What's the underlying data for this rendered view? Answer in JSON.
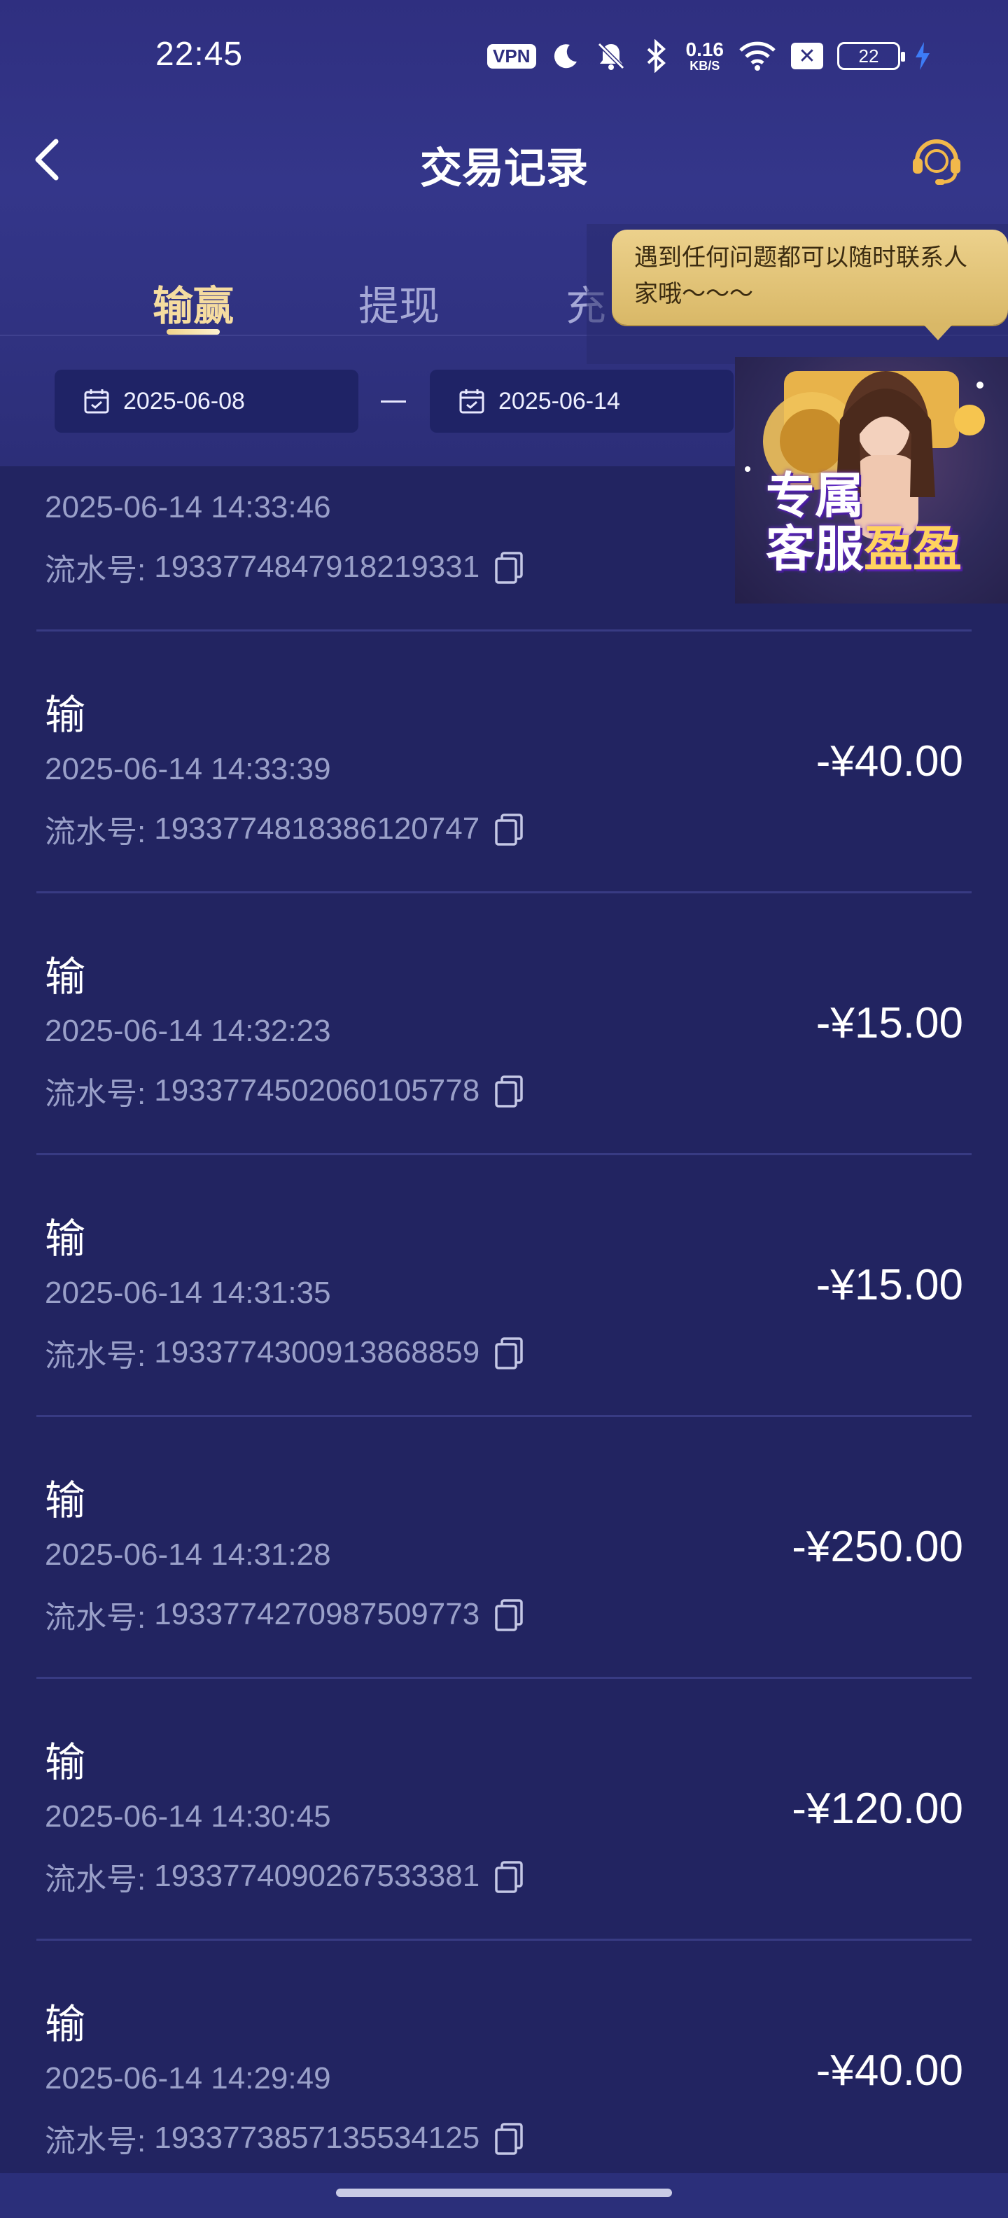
{
  "status_bar": {
    "time": "22:45",
    "vpn": "VPN",
    "net_speed_value": "0.16",
    "net_speed_unit": "KB/S",
    "battery": "22",
    "icons": [
      "vpn-icon",
      "moon-icon",
      "bell-off-icon",
      "bluetooth-icon",
      "wifi-icon",
      "sim-x-icon",
      "battery-icon",
      "charging-icon"
    ]
  },
  "header": {
    "title": "交易记录",
    "back_icon": "chevron-left-icon",
    "support_icon": "headset-icon"
  },
  "tabs": [
    {
      "label": "输赢",
      "active": true
    },
    {
      "label": "提现",
      "active": false
    },
    {
      "label": "充",
      "active": false
    }
  ],
  "filters": {
    "start_date": "2025-06-08",
    "end_date": "2025-06-14",
    "separator": "—"
  },
  "support_promo": {
    "tooltip_line1": "遇到任何问题都可以随时联系人",
    "tooltip_line2": "家哦～～～",
    "badge_line1": "专属",
    "badge_line2": "客服",
    "badge_name": "盈盈"
  },
  "records": [
    {
      "type": "",
      "time": "2025-06-14 14:33:46",
      "serial_label": "流水号:",
      "serial": "1933774847918219331",
      "amount": ""
    },
    {
      "type": "输",
      "time": "2025-06-14 14:33:39",
      "serial_label": "流水号:",
      "serial": "1933774818386120747",
      "amount": "-¥40.00"
    },
    {
      "type": "输",
      "time": "2025-06-14 14:32:23",
      "serial_label": "流水号:",
      "serial": "1933774502060105778",
      "amount": "-¥15.00"
    },
    {
      "type": "输",
      "time": "2025-06-14 14:31:35",
      "serial_label": "流水号:",
      "serial": "1933774300913868859",
      "amount": "-¥15.00"
    },
    {
      "type": "输",
      "time": "2025-06-14 14:31:28",
      "serial_label": "流水号:",
      "serial": "1933774270987509773",
      "amount": "-¥250.00"
    },
    {
      "type": "输",
      "time": "2025-06-14 14:30:45",
      "serial_label": "流水号:",
      "serial": "1933774090267533381",
      "amount": "-¥120.00"
    },
    {
      "type": "输",
      "time": "2025-06-14 14:29:49",
      "serial_label": "流水号:",
      "serial": "1933773857135534125",
      "amount": "-¥40.00"
    }
  ],
  "colors": {
    "background": "#222461",
    "header": "#34368a",
    "accent_tab": "#f5dca0",
    "muted_text": "#9aa0c9",
    "tooltip": "#e3c57a"
  }
}
